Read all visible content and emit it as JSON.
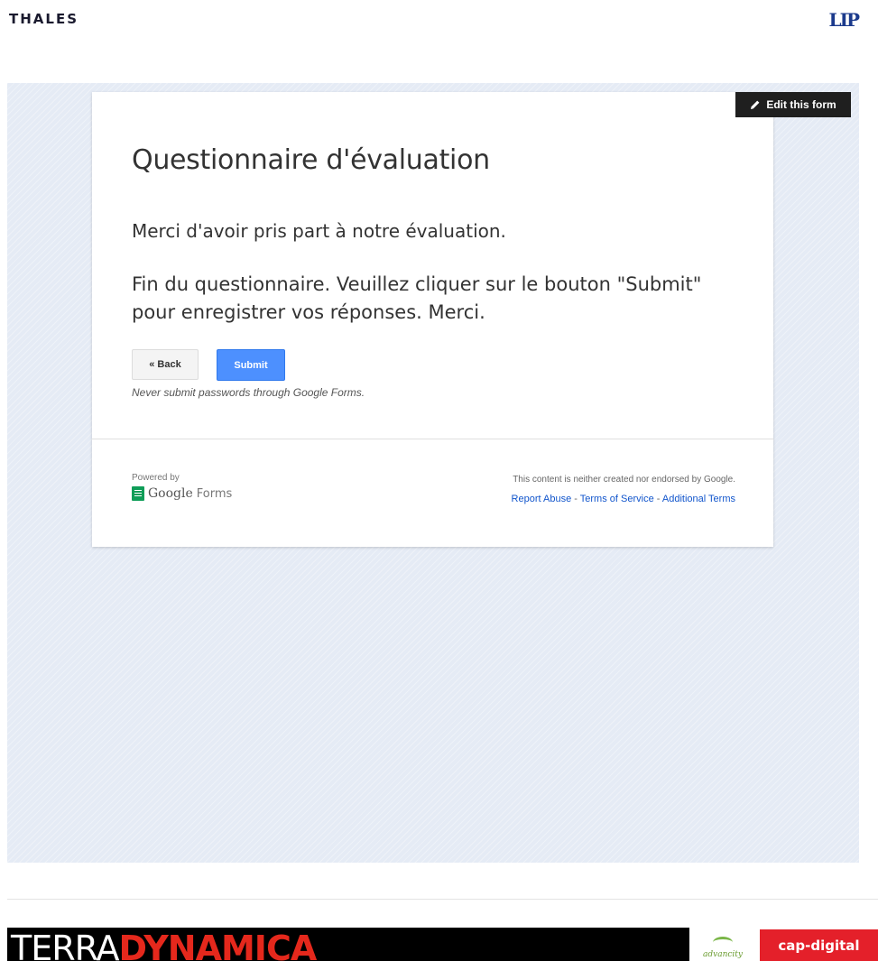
{
  "header": {
    "left_logo": "THALES",
    "right_logo": "LIP"
  },
  "edit_button": {
    "label": "Edit this form",
    "icon": "pencil-icon"
  },
  "form": {
    "title": "Questionnaire d'évaluation",
    "thanks_message": "Merci d'avoir pris part à notre évaluation.",
    "end_message": "Fin du questionnaire. Veuillez cliquer sur le bouton \"Submit\" pour enregistrer vos réponses. Merci.",
    "back_label": "« Back",
    "submit_label": "Submit",
    "password_warning": "Never submit passwords through Google Forms."
  },
  "footer": {
    "powered_by": "Powered by",
    "brand_google": "Google",
    "brand_forms": "Forms",
    "disclaimer": "This content is neither created nor endorsed by Google.",
    "links": {
      "report_abuse": "Report Abuse",
      "terms_of_service": "Terms of Service",
      "additional_terms": "Additional Terms",
      "separator": " - "
    }
  },
  "sponsors": {
    "terra_part1": "TERRA",
    "terra_part2": "DYNAMICA",
    "advancity": "advancity",
    "capdigital": "cap-digital"
  },
  "colors": {
    "submit_blue": "#4d90fe",
    "link_blue": "#1155cc",
    "forms_green": "#0f9d58",
    "terra_red": "#e5281c",
    "capdigital_red": "#e4202a",
    "background": "#e5ebf5"
  }
}
